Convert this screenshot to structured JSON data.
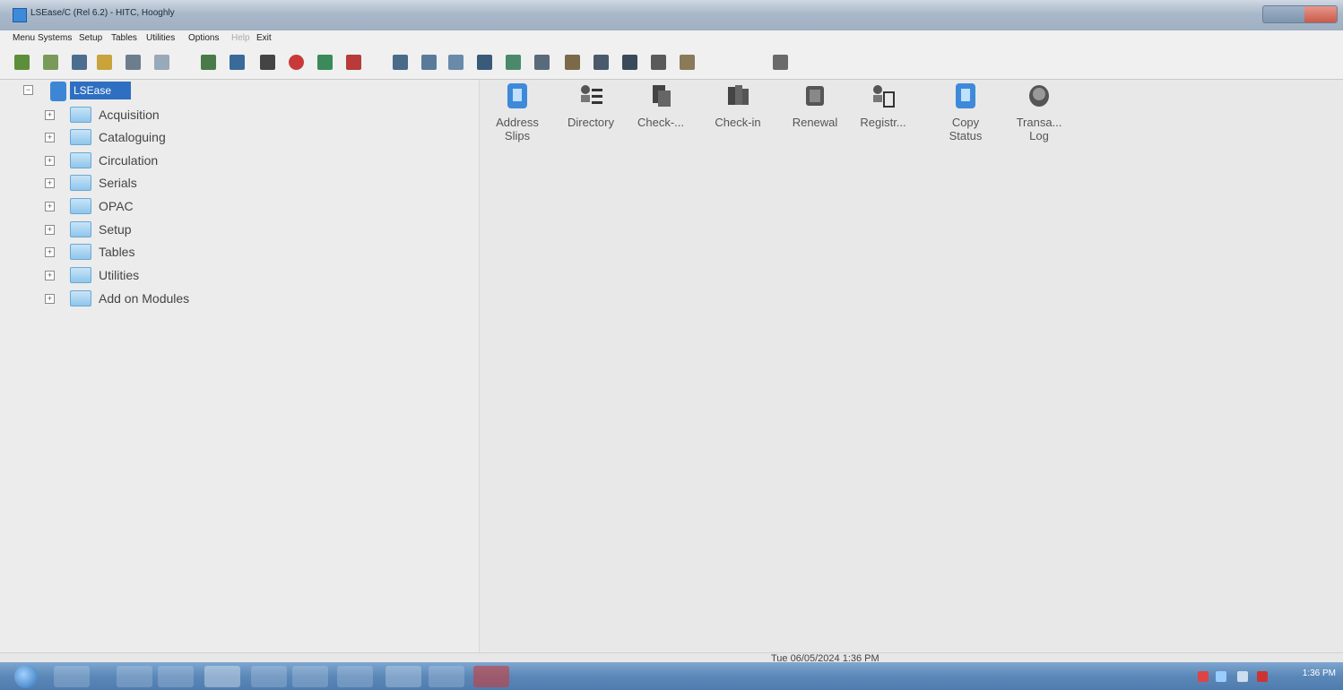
{
  "window": {
    "title": "LSEase/C (Rel 6.2) - HITC, Hooghly"
  },
  "menubar": {
    "items": [
      "Menu",
      "Systems",
      "Setup",
      "Tables",
      "Utilities",
      "Options",
      "Help",
      "Exit"
    ]
  },
  "tree": {
    "root_label": "LSEase",
    "nodes": [
      "Acquisition",
      "Cataloguing",
      "Circulation",
      "Serials",
      "OPAC",
      "Setup",
      "Tables",
      "Utilities",
      "Add on Modules"
    ]
  },
  "pane": {
    "items": [
      {
        "label": "Address\nSlips"
      },
      {
        "label": "Directory"
      },
      {
        "label": "Check-..."
      },
      {
        "label": "Check-in"
      },
      {
        "label": "Renewal"
      },
      {
        "label": "Registr..."
      },
      {
        "label": "Copy\nStatus"
      },
      {
        "label": "Transa...\nLog"
      }
    ]
  },
  "statusbar": {
    "datetime": "Tue 06/05/2024 1:36 PM"
  },
  "taskbar": {
    "clock": "1:36 PM"
  },
  "colors": {
    "accent": "#2f6fc2",
    "folder": "#8fc6ec"
  }
}
